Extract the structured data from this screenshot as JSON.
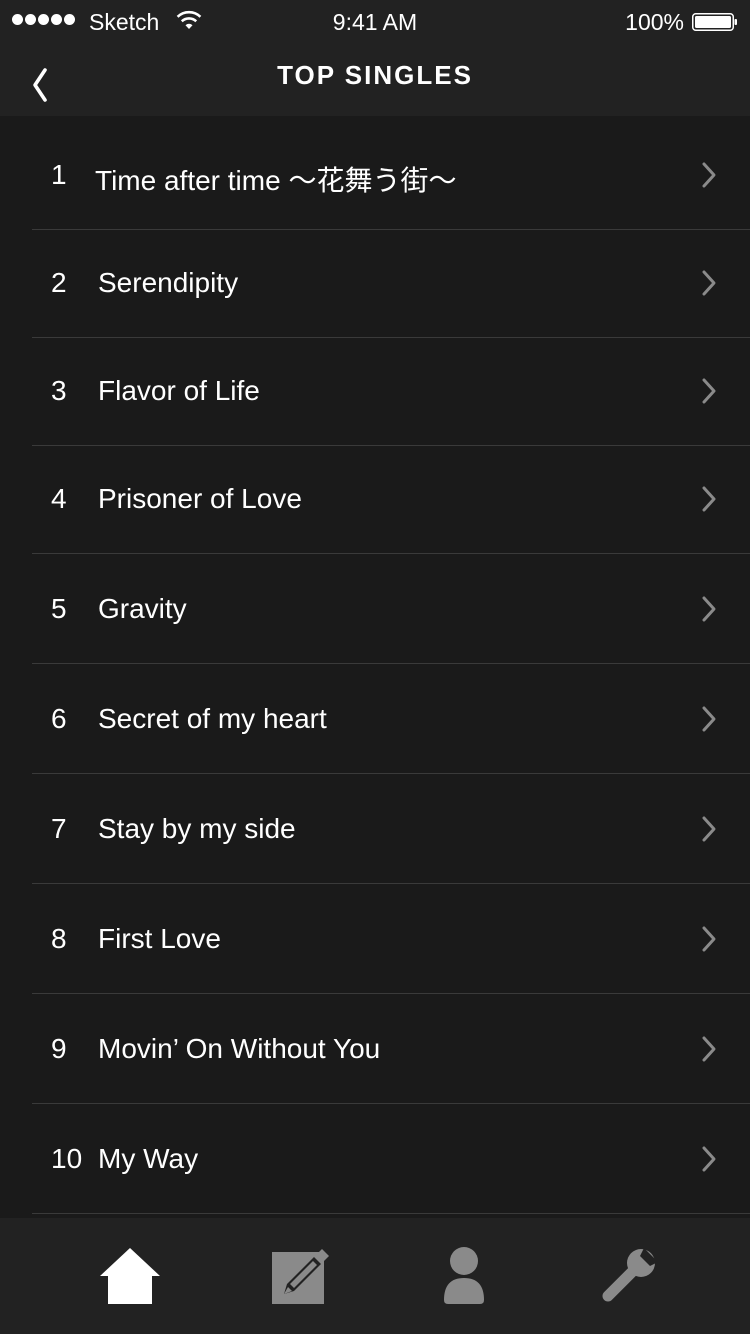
{
  "status_bar": {
    "carrier": "Sketch",
    "time": "9:41 AM",
    "battery": "100%"
  },
  "nav": {
    "title": "TOP SINGLES",
    "back_icon": "chevron-left-icon"
  },
  "colors": {
    "background": "#1a1a1a",
    "bar_background": "#222222",
    "separator": "#3a3a3a",
    "active_tab": "#ffffff",
    "inactive_tab": "#8a8a8a",
    "chevron": "#8a8a8a"
  },
  "singles": [
    {
      "rank": "1",
      "title": "Time after time 〜花舞う街〜"
    },
    {
      "rank": "2",
      "title": "Serendipity"
    },
    {
      "rank": "3",
      "title": "Flavor of Life"
    },
    {
      "rank": "4",
      "title": "Prisoner of Love"
    },
    {
      "rank": "5",
      "title": "Gravity"
    },
    {
      "rank": "6",
      "title": "Secret of my heart"
    },
    {
      "rank": "7",
      "title": "Stay by my side"
    },
    {
      "rank": "8",
      "title": "First Love"
    },
    {
      "rank": "9",
      "title": "Movin’ On Without You"
    },
    {
      "rank": "10",
      "title": "My Way"
    }
  ],
  "tabs": [
    {
      "icon": "home-icon",
      "active": true
    },
    {
      "icon": "edit-icon",
      "active": false
    },
    {
      "icon": "user-icon",
      "active": false
    },
    {
      "icon": "wrench-icon",
      "active": false
    }
  ]
}
